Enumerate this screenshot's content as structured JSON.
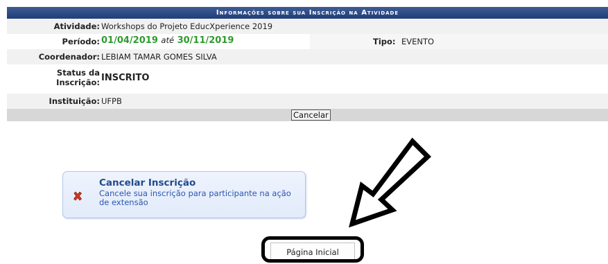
{
  "panel": {
    "title": "Informações sobre sua Inscrição na Atividade",
    "rows": {
      "atividade_label": "Atividade:",
      "atividade_value": "Workshops do Projeto EducXperience 2019",
      "periodo_label": "Período:",
      "periodo_start": "01/04/2019",
      "periodo_sep": "até",
      "periodo_end": "30/11/2019",
      "tipo_label": "Tipo:",
      "tipo_value": "EVENTO",
      "coordenador_label": "Coordenador:",
      "coordenador_value": "LEBIAM TAMAR GOMES SILVA",
      "status_label_line1": "Status da",
      "status_label_line2": "Inscrição:",
      "status_value": "INSCRITO",
      "instituicao_label": "Instituição:",
      "instituicao_value": "UFPB"
    },
    "cancel_button": "Cancelar"
  },
  "action_box": {
    "icon": "red-x-icon",
    "title": "Cancelar Inscrição",
    "description": "Cancele sua inscrição para participante na ação de extensão"
  },
  "home_button": "Página Inicial",
  "colors": {
    "header_blue": "#1f3d78",
    "date_green": "#2f9a2f",
    "link_blue": "#2b55b0",
    "cancel_red": "#d33a1e"
  }
}
